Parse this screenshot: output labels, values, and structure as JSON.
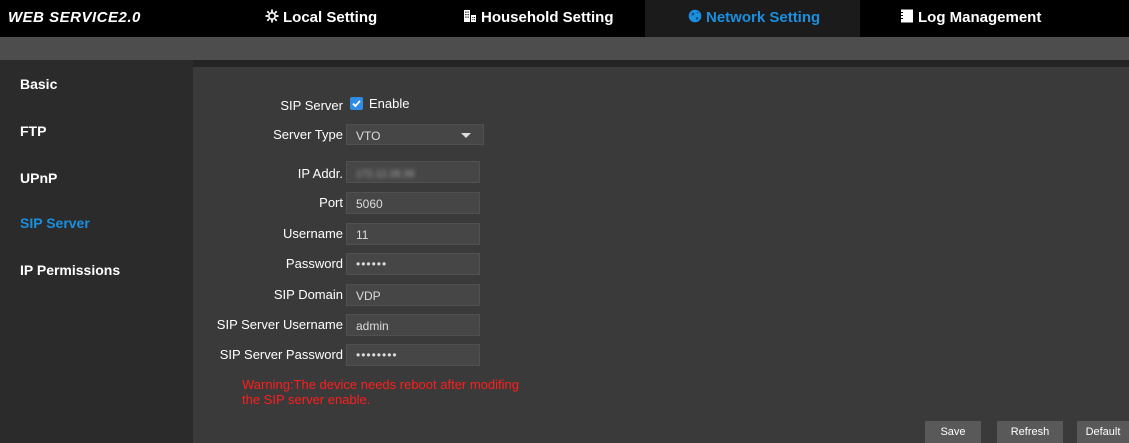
{
  "brand": "WEB SERVICE2.0",
  "nav": {
    "local_setting": "Local Setting",
    "household_setting": "Household Setting",
    "network_setting": "Network Setting",
    "log_management": "Log Management"
  },
  "sidebar": {
    "items": [
      {
        "label": "Basic"
      },
      {
        "label": "FTP"
      },
      {
        "label": "UPnP"
      },
      {
        "label": "SIP Server"
      },
      {
        "label": "IP Permissions"
      }
    ]
  },
  "form": {
    "sip_server_label": "SIP Server",
    "enable_label": "Enable",
    "sip_server_enabled": true,
    "server_type_label": "Server Type",
    "server_type_value": "VTO",
    "ip_addr_label": "IP Addr.",
    "ip_addr_value": "172.12.28.39",
    "port_label": "Port",
    "port_value": "5060",
    "username_label": "Username",
    "username_value": "11",
    "password_label": "Password",
    "password_value": "••••••",
    "sip_domain_label": "SIP Domain",
    "sip_domain_value": "VDP",
    "sip_server_username_label": "SIP Server Username",
    "sip_server_username_value": "admin",
    "sip_server_password_label": "SIP Server Password",
    "sip_server_password_value": "••••••••",
    "warning_line1": "Warning:The device needs reboot after modifing",
    "warning_line2": "the SIP server enable."
  },
  "buttons": {
    "save": "Save",
    "refresh": "Refresh",
    "default": "Default"
  },
  "colors": {
    "accent": "#1a8fe0",
    "warning": "#ff1d1d"
  }
}
